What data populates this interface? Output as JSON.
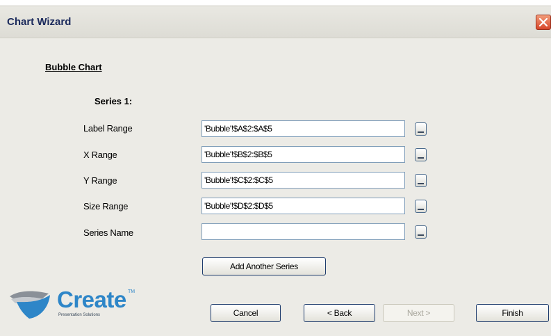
{
  "window": {
    "title": "Chart Wizard"
  },
  "section_title": "Bubble Chart",
  "series_title": "Series 1:",
  "fields": [
    {
      "label": "Label Range",
      "value": "'Bubble'!$A$2:$A$5"
    },
    {
      "label": "X Range",
      "value": "'Bubble'!$B$2:$B$5"
    },
    {
      "label": "Y Range",
      "value": "'Bubble'!$C$2:$C$5"
    },
    {
      "label": "Size Range",
      "value": "'Bubble'!$D$2:$D$5"
    },
    {
      "label": "Series Name",
      "value": ""
    }
  ],
  "add_series_label": "Add Another Series",
  "buttons": {
    "cancel": "Cancel",
    "back": "< Back",
    "next": "Next >",
    "finish": "Finish"
  },
  "logo": {
    "word": "Create",
    "tagline": "Presentation Solutions",
    "tm": "TM"
  },
  "colors": {
    "title_text": "#1b2a5c",
    "close_button": "#d7462a",
    "logo_blue": "#2e86c8",
    "input_border": "#7f9db9",
    "button_border": "#1d3b6c"
  },
  "icons": {
    "close": "close-icon",
    "range_picker": "range-picker-icon",
    "logo_mark": "create-logo-icon"
  }
}
